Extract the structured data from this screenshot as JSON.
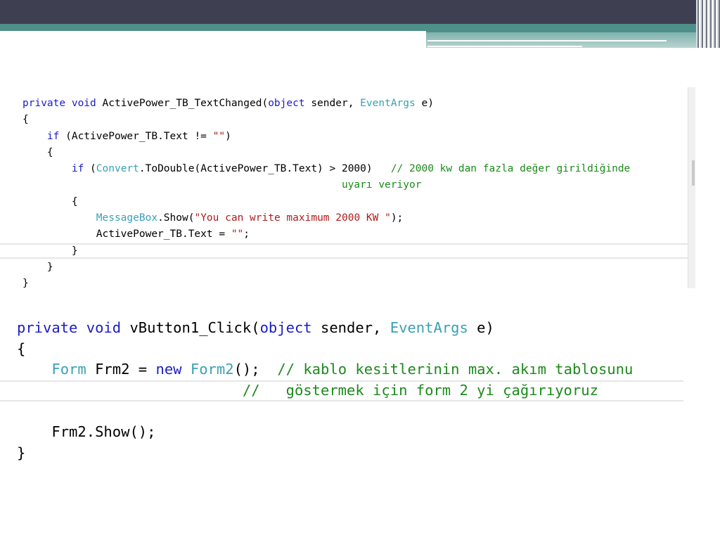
{
  "snippet1": {
    "lines": [
      [
        {
          "t": "private void ",
          "c": "kw"
        },
        {
          "t": "ActivePower_TB_TextChanged(",
          "c": ""
        },
        {
          "t": "object",
          "c": "kw"
        },
        {
          "t": " sender, ",
          "c": ""
        },
        {
          "t": "EventArgs",
          "c": "ty"
        },
        {
          "t": " e)",
          "c": ""
        }
      ],
      [
        {
          "t": "{",
          "c": ""
        }
      ],
      [
        {
          "t": "    ",
          "c": ""
        },
        {
          "t": "if",
          "c": "kw"
        },
        {
          "t": " (ActivePower_TB.Text != ",
          "c": ""
        },
        {
          "t": "\"\"",
          "c": "str"
        },
        {
          "t": ")",
          "c": ""
        }
      ],
      [
        {
          "t": "    {",
          "c": ""
        }
      ],
      [
        {
          "t": "        ",
          "c": ""
        },
        {
          "t": "if",
          "c": "kw"
        },
        {
          "t": " (",
          "c": ""
        },
        {
          "t": "Convert",
          "c": "ty"
        },
        {
          "t": ".ToDouble(ActivePower_TB.Text) > 2000)   ",
          "c": ""
        },
        {
          "t": "// 2000 kw dan fazla değer girildiğinde",
          "c": "cm"
        }
      ],
      [
        {
          "t": "                                                    ",
          "c": ""
        },
        {
          "t": "uyarı veriyor",
          "c": "cm"
        }
      ],
      [
        {
          "t": "        {",
          "c": ""
        }
      ],
      [
        {
          "t": "            ",
          "c": ""
        },
        {
          "t": "MessageBox",
          "c": "ty"
        },
        {
          "t": ".Show(",
          "c": ""
        },
        {
          "t": "\"You can write maximum 2000 KW \"",
          "c": "str"
        },
        {
          "t": ");",
          "c": ""
        }
      ],
      [
        {
          "t": "            ActivePower_TB.Text = ",
          "c": ""
        },
        {
          "t": "\"\"",
          "c": "str"
        },
        {
          "t": ";",
          "c": ""
        }
      ],
      [
        {
          "t": "        }",
          "c": ""
        }
      ],
      [
        {
          "t": "    }",
          "c": ""
        }
      ],
      [
        {
          "t": "}",
          "c": ""
        }
      ]
    ]
  },
  "snippet2": {
    "lines": [
      [
        {
          "t": "private void ",
          "c": "kw"
        },
        {
          "t": "vButton1_Click(",
          "c": ""
        },
        {
          "t": "object",
          "c": "kw"
        },
        {
          "t": " sender, ",
          "c": ""
        },
        {
          "t": "EventArgs",
          "c": "ty"
        },
        {
          "t": " e)",
          "c": ""
        }
      ],
      [
        {
          "t": "{",
          "c": ""
        }
      ],
      [
        {
          "t": "    ",
          "c": ""
        },
        {
          "t": "Form",
          "c": "ty"
        },
        {
          "t": " Frm2 = ",
          "c": ""
        },
        {
          "t": "new",
          "c": "kw"
        },
        {
          "t": " ",
          "c": ""
        },
        {
          "t": "Form2",
          "c": "ty"
        },
        {
          "t": "();  ",
          "c": ""
        },
        {
          "t": "// kablo kesitlerinin max. akım tablosunu",
          "c": "cm"
        }
      ],
      [
        {
          "t": "                          ",
          "c": ""
        },
        {
          "t": "//   göstermek için form 2 yi çağırıyoruz",
          "c": "cm"
        }
      ],
      [
        {
          "t": "",
          "c": ""
        }
      ],
      [
        {
          "t": "    Frm2.Show();",
          "c": ""
        }
      ],
      [
        {
          "t": "}",
          "c": ""
        }
      ]
    ]
  },
  "colors": {
    "keyword": "#1c1cc7",
    "type": "#3aa0b5",
    "string": "#b01c1c",
    "comment": "#1c8a1c",
    "header_dark": "#3f3f52",
    "header_teal": "#4e8f89"
  }
}
